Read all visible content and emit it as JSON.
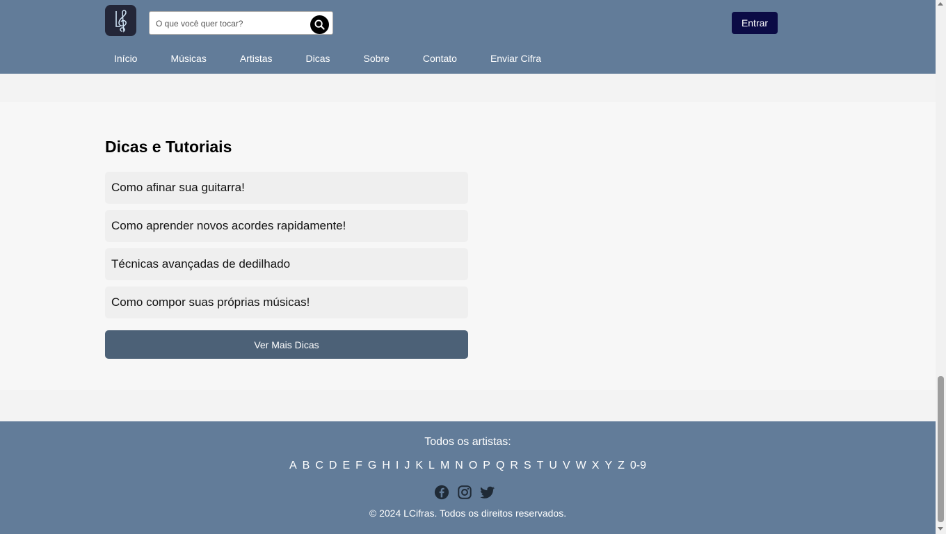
{
  "header": {
    "search": {
      "placeholder": "O que você quer tocar?",
      "value": ""
    },
    "login_label": "Entrar",
    "nav": [
      "Início",
      "Músicas",
      "Artistas",
      "Dicas",
      "Sobre",
      "Contato",
      "Enviar Cifra"
    ]
  },
  "tips": {
    "title": "Dicas e Tutoriais",
    "items": [
      "Como afinar sua guitarra!",
      "Como aprender novos acordes rapidamente!",
      "Técnicas avançadas de dedilhado",
      "Como compor suas próprias músicas!"
    ],
    "more_label": "Ver Mais Dicas"
  },
  "footer": {
    "title": "Todos os artistas:",
    "letters": [
      "A",
      "B",
      "C",
      "D",
      "E",
      "F",
      "G",
      "H",
      "I",
      "J",
      "K",
      "L",
      "M",
      "N",
      "O",
      "P",
      "Q",
      "R",
      "S",
      "T",
      "U",
      "V",
      "W",
      "X",
      "Y",
      "Z",
      "0-9"
    ],
    "socials": [
      "facebook-icon",
      "instagram-icon",
      "twitter-icon"
    ],
    "copyright": "© 2024 LCifras. Todos os direitos reservados."
  },
  "colors": {
    "header_bg": "#627c99",
    "login_bg": "#0b0b45",
    "button_bg": "#4c6177",
    "logo_bg": "#232638"
  }
}
